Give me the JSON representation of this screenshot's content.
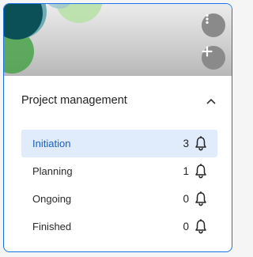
{
  "card": {
    "title": "Project management",
    "actions": [
      {
        "name": "more-options",
        "icon": "more-vertical-icon"
      },
      {
        "name": "add",
        "icon": "plus-icon"
      }
    ],
    "collapse_icon": "chevron-up-icon"
  },
  "stages": [
    {
      "label": "Initiation",
      "count": "3",
      "selected": true,
      "icon": "bell-icon"
    },
    {
      "label": "Planning",
      "count": "1",
      "selected": false,
      "icon": "bell-icon"
    },
    {
      "label": "Ongoing",
      "count": "0",
      "selected": false,
      "icon": "bell-icon"
    },
    {
      "label": "Finished",
      "count": "0",
      "selected": false,
      "icon": "bell-icon"
    }
  ],
  "colors": {
    "accent": "#1a73e8",
    "selected_bg": "#e0ebfb",
    "selected_text": "#1a5fc4",
    "banner_circle_dark": "#0b4f57",
    "banner_circle_light": "#b8e0a8",
    "banner_circle_teal": "#6fa9b3",
    "fab_bg": "#8a8a8a"
  }
}
